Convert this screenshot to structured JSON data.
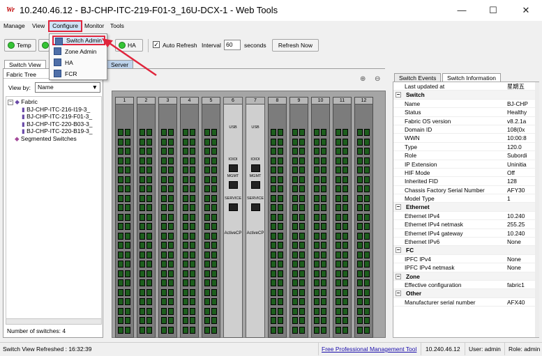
{
  "window": {
    "icon_text": "Wr",
    "title": "10.240.46.12 - BJ-CHP-ITC-219-F01-3_16U-DCX-1 - Web Tools",
    "controls": {
      "minimize": "—",
      "maximize": "☐",
      "close": "✕"
    }
  },
  "menubar": {
    "items": [
      "Manage",
      "View",
      "Configure",
      "Monitor",
      "Tools"
    ]
  },
  "dropdown": {
    "items": [
      "Switch Admin",
      "Zone Admin",
      "HA",
      "FCR"
    ]
  },
  "toolbar": {
    "temp": "Temp",
    "ha": "HA",
    "auto_refresh": "Auto Refresh",
    "interval_label": "Interval",
    "interval_value": "60",
    "seconds_label": "seconds",
    "refresh_now": "Refresh Now"
  },
  "left_tabs": [
    "Switch View",
    "Server"
  ],
  "left_panel": {
    "fabric_tree_label": "Fabric Tree",
    "view_by_label": "View by:",
    "view_by_value": "Name",
    "tree": {
      "root": "Fabric",
      "switches": [
        "BJ-CHP-ITC-216-I19-3_",
        "BJ-CHP-ITC-219-F01-3_",
        "BJ-CHP-ITC-220-B03-3_",
        "BJ-CHP-ITC-220-B19-3_"
      ],
      "segmented": "Segmented Switches"
    },
    "num_switches": "Number of switches:  4"
  },
  "chassis": {
    "slots": [
      "1",
      "2",
      "3",
      "4",
      "5",
      "6",
      "7",
      "8",
      "9",
      "10",
      "11",
      "12"
    ],
    "cp_labels": [
      "ActiveCP",
      "ActiveCP"
    ],
    "cp_port_labels": {
      "usb": "USB",
      "mgmt": "MGMT",
      "service": "SERVICE",
      "ioioi": "IOIOI"
    }
  },
  "right_tabs": [
    "Switch Events",
    "Switch Information"
  ],
  "switch_info": {
    "last_updated_label": "Last updated at",
    "last_updated_value": "星期五",
    "sections": [
      {
        "name": "Switch",
        "rows": [
          [
            "Name",
            "BJ-CHP"
          ],
          [
            "Status",
            "Healthy"
          ],
          [
            "Fabric OS version",
            "v8.2.1a"
          ],
          [
            "Domain ID",
            "108(0x"
          ],
          [
            "WWN",
            "10:00:8"
          ],
          [
            "Type",
            "120.0"
          ],
          [
            "Role",
            "Subordi"
          ],
          [
            "IP Extension",
            "Uninitia"
          ],
          [
            "HIF Mode",
            "Off"
          ],
          [
            "Inherited FID",
            "128"
          ],
          [
            "Chassis Factory Serial Number",
            "AFY30"
          ],
          [
            "Model Type",
            "1"
          ]
        ]
      },
      {
        "name": "Ethernet",
        "rows": [
          [
            "Ethernet IPv4",
            "10.240"
          ],
          [
            "Ethernet IPv4 netmask",
            "255.25"
          ],
          [
            "Ethernet IPv4 gateway",
            "10.240"
          ],
          [
            "Ethernet IPv6",
            "None"
          ]
        ]
      },
      {
        "name": "FC",
        "rows": [
          [
            "IPFC IPv4",
            "None"
          ],
          [
            "IPFC IPv4 netmask",
            "None"
          ]
        ]
      },
      {
        "name": "Zone",
        "rows": [
          [
            "Effective configuration",
            "fabric1"
          ]
        ]
      },
      {
        "name": "Other",
        "rows": [
          [
            "Manufacturer serial number",
            "AFX40"
          ]
        ]
      }
    ]
  },
  "statusbar": {
    "refreshed": "Switch View Refreshed : 16:32:39",
    "free_tool": "Free Professional Management Tool",
    "ip": "10.240.46.12",
    "user": "User: admin",
    "role": "Role: admin"
  },
  "colors": {
    "accent_red": "#e0253c",
    "status_green": "#35c435",
    "link_blue": "#1a0dab"
  }
}
